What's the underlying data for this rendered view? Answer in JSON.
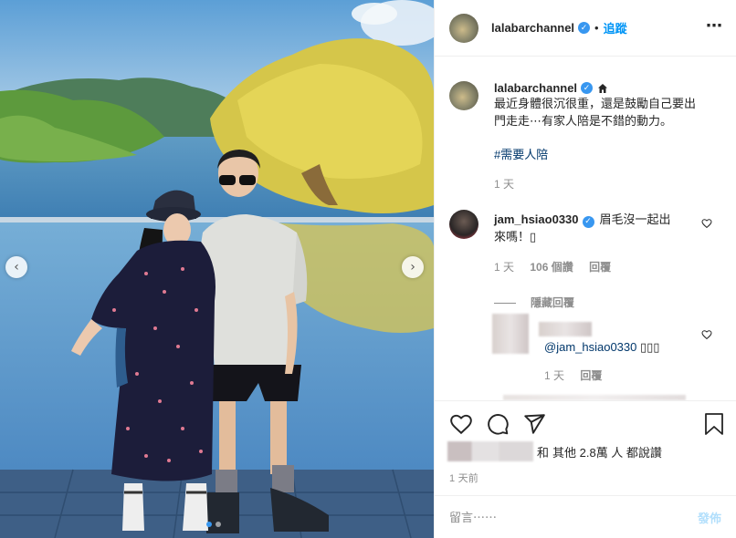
{
  "post": {
    "username": "lalabarchannel",
    "separator": "•",
    "follow_label": "追蹤",
    "more_icon": "more-options-icon"
  },
  "caption": {
    "username": "lalabarchannel",
    "line1": "最近身體很沉很重，還是鼓勵自己要出",
    "line2": "門走走⋯有家人陪是不錯的動力。",
    "hashtag": "#需要人陪",
    "time": "1 天"
  },
  "comments": [
    {
      "username": "jam_hsiao0330",
      "text_line1": "眉毛沒一起出",
      "text_line2": "來嗎！▯",
      "time": "1 天",
      "likes": "106 個讚",
      "reply_label": "回覆"
    }
  ],
  "hide_replies_label": "隱藏回覆",
  "reply": {
    "mention": "@jam_hsiao0330",
    "text": "▯▯▯",
    "time": "1 天",
    "reply_label": "回覆"
  },
  "likes_summary": {
    "and_label": "和",
    "others_label": "其他 2.8萬 人 都說讚"
  },
  "posted_time": "1 天前",
  "comment_box": {
    "placeholder": "留言⋯⋯",
    "post_label": "發佈"
  },
  "carousel": {
    "total": 2,
    "active": 1
  },
  "colors": {
    "accent": "#0095f6",
    "verified": "#3897f0",
    "hashtag": "#00376b",
    "muted": "#8e8e8e"
  }
}
